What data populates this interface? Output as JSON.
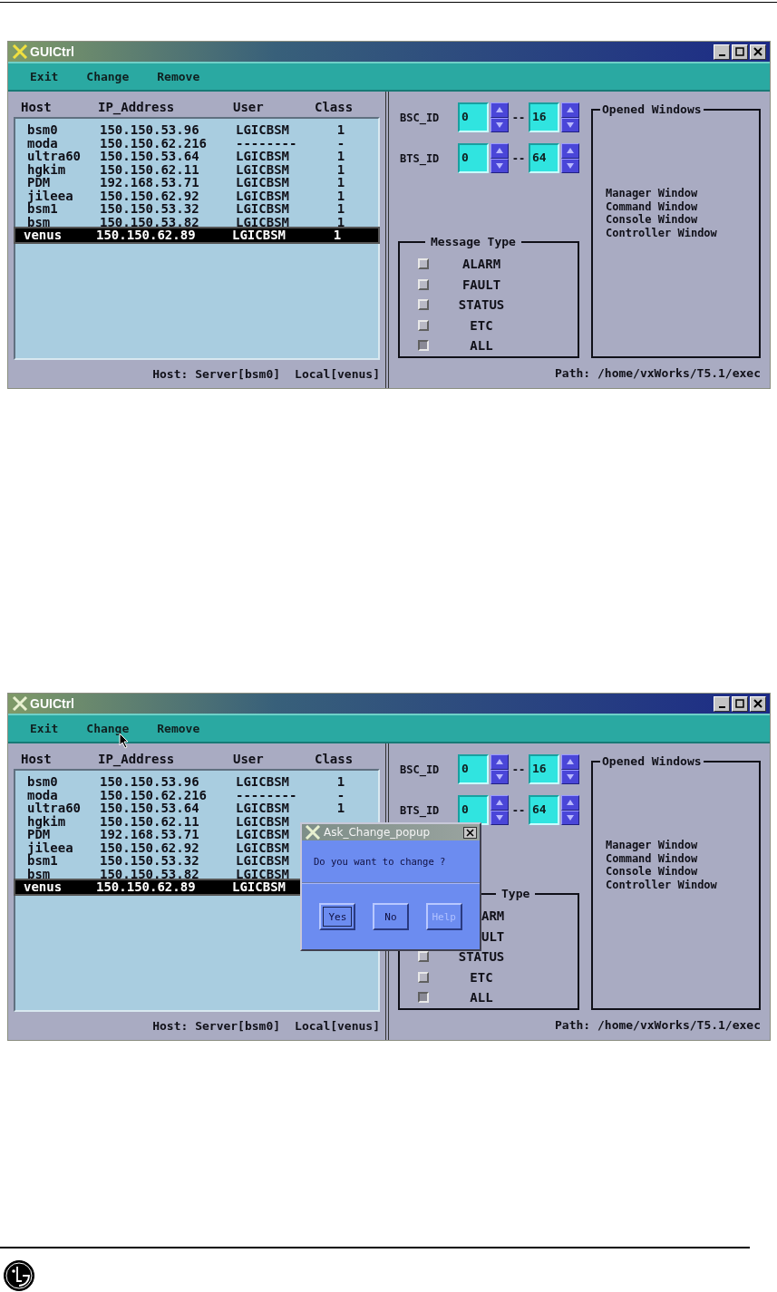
{
  "windows": [
    {
      "title": "GUICtrl",
      "menu": [
        {
          "label": "Exit",
          "hovered": false
        },
        {
          "label": "Change",
          "hovered": false
        },
        {
          "label": "Remove",
          "hovered": false
        }
      ],
      "columns": [
        "Host",
        "IP_Address",
        "User",
        "Class"
      ],
      "rows": [
        {
          "host": "bsm0",
          "ip": "150.150.53.96",
          "user": "LGICBSM",
          "class": "1",
          "selected": false
        },
        {
          "host": "moda",
          "ip": "150.150.62.216",
          "user": "--------",
          "class": "-",
          "selected": false
        },
        {
          "host": "ultra60",
          "ip": "150.150.53.64",
          "user": "LGICBSM",
          "class": "1",
          "selected": false
        },
        {
          "host": "hgkim",
          "ip": "150.150.62.11",
          "user": "LGICBSM",
          "class": "1",
          "selected": false
        },
        {
          "host": "PDM",
          "ip": "192.168.53.71",
          "user": "LGICBSM",
          "class": "1",
          "selected": false
        },
        {
          "host": "jileea",
          "ip": "150.150.62.92",
          "user": "LGICBSM",
          "class": "1",
          "selected": false
        },
        {
          "host": "bsm1",
          "ip": "150.150.53.32",
          "user": "LGICBSM",
          "class": "1",
          "selected": false
        },
        {
          "host": "bsm",
          "ip": "150.150.53.82",
          "user": "LGICBSM",
          "class": "1",
          "selected": false
        },
        {
          "host": "venus",
          "ip": "150.150.62.89",
          "user": "LGICBSM",
          "class": "1",
          "selected": true
        }
      ],
      "ranges": [
        {
          "label": "BSC_ID",
          "from": "0",
          "separator": "--",
          "to": "16"
        },
        {
          "label": "BTS_ID",
          "from": "0",
          "separator": "--",
          "to": "64"
        }
      ],
      "message_type": {
        "legend": "Message Type",
        "items": [
          {
            "label": "ALARM",
            "checked": false
          },
          {
            "label": "FAULT",
            "checked": false
          },
          {
            "label": "STATUS",
            "checked": false
          },
          {
            "label": "ETC",
            "checked": false
          },
          {
            "label": "ALL",
            "checked": true
          }
        ]
      },
      "opened_windows": {
        "legend": "Opened Windows",
        "items": [
          "Manager Window",
          "Command Window",
          "Console Window",
          "Controller Window"
        ]
      },
      "status": {
        "host": "Host: Server[bsm0]",
        "local": "Local[venus]",
        "path": "Path: /home/vxWorks/T5.1/exec"
      }
    },
    {
      "title": "GUICtrl",
      "menu": [
        {
          "label": "Exit",
          "hovered": false
        },
        {
          "label": "Change",
          "hovered": true
        },
        {
          "label": "Remove",
          "hovered": false
        }
      ],
      "columns": [
        "Host",
        "IP_Address",
        "User",
        "Class"
      ],
      "rows": [
        {
          "host": "bsm0",
          "ip": "150.150.53.96",
          "user": "LGICBSM",
          "class": "1",
          "selected": false
        },
        {
          "host": "moda",
          "ip": "150.150.62.216",
          "user": "--------",
          "class": "-",
          "selected": false
        },
        {
          "host": "ultra60",
          "ip": "150.150.53.64",
          "user": "LGICBSM",
          "class": "1",
          "selected": false
        },
        {
          "host": "hgkim",
          "ip": "150.150.62.11",
          "user": "LGICBSM",
          "selected": false
        },
        {
          "host": "PDM",
          "ip": "192.168.53.71",
          "user": "LGICBSM",
          "selected": false
        },
        {
          "host": "jileea",
          "ip": "150.150.62.92",
          "user": "LGICBSM",
          "selected": false
        },
        {
          "host": "bsm1",
          "ip": "150.150.53.32",
          "user": "LGICBSM",
          "selected": false
        },
        {
          "host": "bsm",
          "ip": "150.150.53.82",
          "user": "LGICBSM",
          "selected": false
        },
        {
          "host": "venus",
          "ip": "150.150.62.89",
          "user": "LGICBSM",
          "selected": true
        }
      ],
      "ranges": [
        {
          "label": "BSC_ID",
          "from": "0",
          "separator": "--",
          "to": "16"
        },
        {
          "label": "BTS_ID",
          "from": "0",
          "separator": "--",
          "to": "64"
        }
      ],
      "message_type": {
        "legend": "Type",
        "items": [
          {
            "label": "ARM"
          },
          {
            "label": "ULT"
          },
          {
            "label": "STATUS",
            "checked": false
          },
          {
            "label": "ETC",
            "checked": false
          },
          {
            "label": "ALL",
            "checked": true
          }
        ]
      },
      "opened_windows": {
        "legend": "Opened Windows",
        "items": [
          "Manager Window",
          "Command Window",
          "Console Window",
          "Controller Window"
        ]
      },
      "status": {
        "host": "Host: Server[bsm0]",
        "local": "Local[venus]",
        "path": "Path: /home/vxWorks/T5.1/exec"
      },
      "popup": {
        "title": "Ask_Change_popup",
        "message": "Do you want to change ?",
        "buttons": [
          {
            "label": "Yes",
            "focused": true,
            "disabled": false
          },
          {
            "label": "No",
            "focused": false,
            "disabled": false
          },
          {
            "label": "Help",
            "focused": false,
            "disabled": true
          }
        ]
      }
    }
  ]
}
